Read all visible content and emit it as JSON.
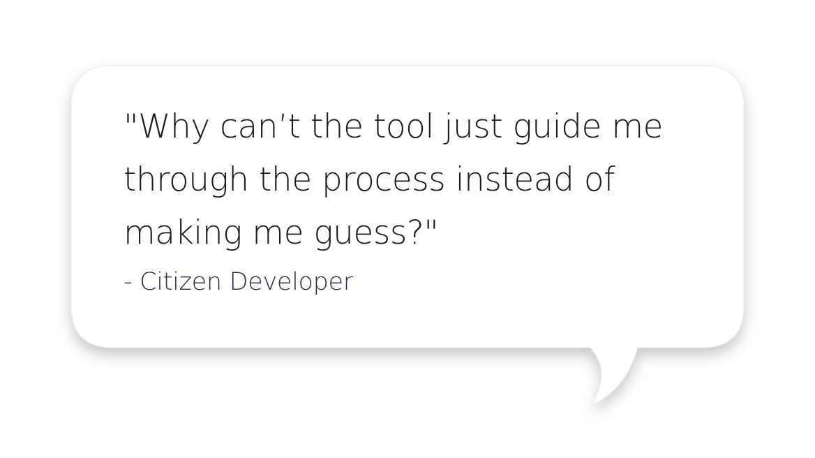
{
  "quote": {
    "text": "\"Why can’t the tool just guide me\nthrough the process instead of\nmaking me guess?\"",
    "attribution": "- Citizen Developer"
  },
  "colors": {
    "background": "#ffffff",
    "bubble": "#ffffff",
    "shadow": "#b8b8b8",
    "quote_text": "#1c1c1c",
    "attribution_text": "#2a2f45"
  }
}
